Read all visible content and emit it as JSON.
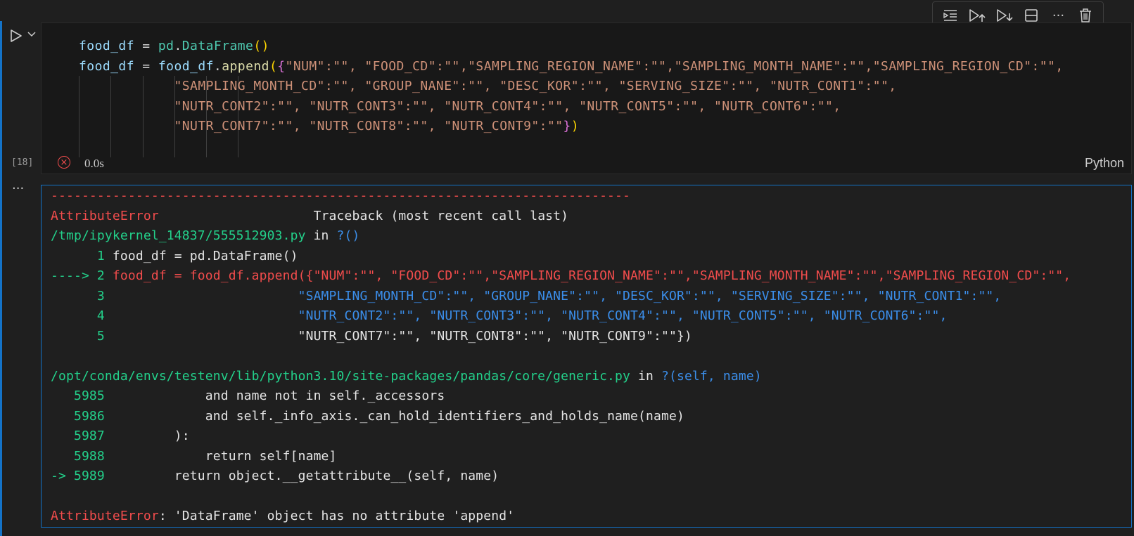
{
  "toolbar": {
    "buttons": [
      "execute-above",
      "execute-cell-and-below",
      "execute-below",
      "split-cell",
      "more",
      "delete"
    ]
  },
  "cell": {
    "execution_count": "[18]",
    "status": "error",
    "duration": "0.0s",
    "language": "Python",
    "code": {
      "l1_var": "food_df",
      "l1_eq": " = ",
      "l1_mod": "pd",
      "l1_dot": ".",
      "l1_cls": "DataFrame",
      "l1_paren": "()",
      "l2_var": "food_df",
      "l2_eq": " = ",
      "l2_var2": "food_df",
      "l2_dot": ".",
      "l2_fn": "append",
      "l2_open": "(",
      "l2_brace": "{",
      "l2_str": "\"NUM\":\"\", \"FOOD_CD\":\"\",\"SAMPLING_REGION_NAME\":\"\",\"SAMPLING_MONTH_NAME\":\"\",\"SAMPLING_REGION_CD\":\"\",",
      "l3_str": "\"SAMPLING_MONTH_CD\":\"\", \"GROUP_NANE\":\"\", \"DESC_KOR\":\"\", \"SERVING_SIZE\":\"\", \"NUTR_CONT1\":\"\",",
      "l4_str": "\"NUTR_CONT2\":\"\", \"NUTR_CONT3\":\"\", \"NUTR_CONT4\":\"\", \"NUTR_CONT5\":\"\", \"NUTR_CONT6\":\"\",",
      "l5_str": "\"NUTR_CONT7\":\"\", \"NUTR_CONT8\":\"\", \"NUTR_CONT9\":\"\"",
      "l5_brace": "}",
      "l5_close": ")"
    }
  },
  "output": {
    "more_label": "···",
    "dashes": "---------------------------------------------------------------------------",
    "err_name": "AttributeError",
    "traceback_header": "Traceback (most recent call last)",
    "file1": "/tmp/ipykernel_14837/555512903.py",
    "in_word": " in ",
    "func1": "?()",
    "line1_no": "      1 ",
    "line1_code": "food_df = pd.DataFrame()",
    "line2_arrow": "----> 2 ",
    "line2_code": "food_df = food_df.append({\"NUM\":\"\", \"FOOD_CD\":\"\",\"SAMPLING_REGION_NAME\":\"\",\"SAMPLING_MONTH_NAME\":\"\",\"SAMPLING_REGION_CD\":\"\",",
    "line3_no": "      3 ",
    "line3_code": "                        \"SAMPLING_MONTH_CD\":\"\", \"GROUP_NANE\":\"\", \"DESC_KOR\":\"\", \"SERVING_SIZE\":\"\", \"NUTR_CONT1\":\"\",",
    "line4_no": "      4 ",
    "line4_code": "                        \"NUTR_CONT2\":\"\", \"NUTR_CONT3\":\"\", \"NUTR_CONT4\":\"\", \"NUTR_CONT5\":\"\", \"NUTR_CONT6\":\"\",",
    "line5_no": "      5 ",
    "line5_code": "                        \"NUTR_CONT7\":\"\", \"NUTR_CONT8\":\"\", \"NUTR_CONT9\":\"\"})",
    "file2": "/opt/conda/envs/testenv/lib/python3.10/site-packages/pandas/core/generic.py",
    "func2": "?(self, name)",
    "g1_no": "   5985 ",
    "g1_code": "            and name not in self._accessors",
    "g2_no": "   5986 ",
    "g2_code": "            and self._info_axis._can_hold_identifiers_and_holds_name(name)",
    "g3_no": "   5987 ",
    "g3_code": "        ):",
    "g4_no": "   5988 ",
    "g4_code": "            return self[name]",
    "g5_arrow": "-> 5989 ",
    "g5_code": "        return object.__getattribute__(self, name)",
    "final_err": "AttributeError",
    "final_msg": ": 'DataFrame' object has no attribute 'append'"
  }
}
